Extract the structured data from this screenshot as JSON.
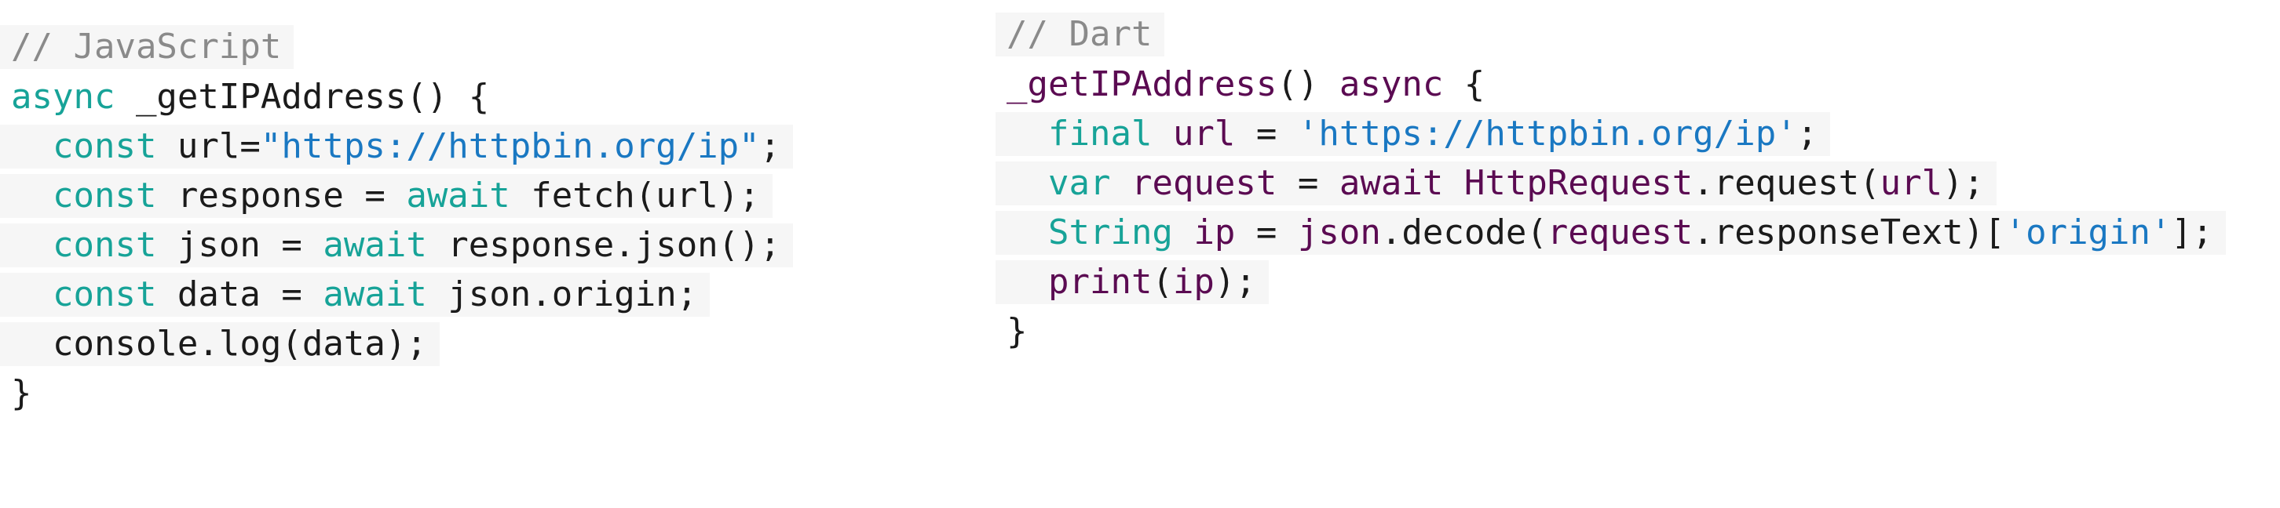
{
  "javascript": {
    "comment": "// JavaScript",
    "lines": [
      {
        "segs": [
          {
            "t": "async",
            "c": "kw-teal"
          },
          {
            "t": " _getIPAddress() {",
            "c": "plain"
          }
        ]
      },
      {
        "segs": [
          {
            "t": "  ",
            "c": "plain"
          },
          {
            "t": "const",
            "c": "kw-teal"
          },
          {
            "t": " url=",
            "c": "plain"
          },
          {
            "t": "\"https://httpbin.org/ip\"",
            "c": "str-blue"
          },
          {
            "t": ";",
            "c": "plain"
          }
        ]
      },
      {
        "segs": [
          {
            "t": "  ",
            "c": "plain"
          },
          {
            "t": "const",
            "c": "kw-teal"
          },
          {
            "t": " response = ",
            "c": "plain"
          },
          {
            "t": "await",
            "c": "kw-teal"
          },
          {
            "t": " fetch(url);",
            "c": "plain"
          }
        ]
      },
      {
        "segs": [
          {
            "t": "  ",
            "c": "plain"
          },
          {
            "t": "const",
            "c": "kw-teal"
          },
          {
            "t": " json = ",
            "c": "plain"
          },
          {
            "t": "await",
            "c": "kw-teal"
          },
          {
            "t": " response.json();",
            "c": "plain"
          }
        ]
      },
      {
        "segs": [
          {
            "t": "  ",
            "c": "plain"
          },
          {
            "t": "const",
            "c": "kw-teal"
          },
          {
            "t": " data = ",
            "c": "plain"
          },
          {
            "t": "await",
            "c": "kw-teal"
          },
          {
            "t": " json.origin;",
            "c": "plain"
          }
        ]
      },
      {
        "segs": [
          {
            "t": "  console.log(data);",
            "c": "plain"
          }
        ]
      },
      {
        "segs": [
          {
            "t": "}",
            "c": "plain"
          }
        ]
      }
    ]
  },
  "dart": {
    "comment": "// Dart",
    "lines": [
      {
        "segs": [
          {
            "t": "_getIPAddress",
            "c": "dart-id"
          },
          {
            "t": "() ",
            "c": "plain"
          },
          {
            "t": "async",
            "c": "dart-id"
          },
          {
            "t": " {",
            "c": "plain"
          }
        ]
      },
      {
        "segs": [
          {
            "t": "  ",
            "c": "plain"
          },
          {
            "t": "final",
            "c": "kw-teal"
          },
          {
            "t": " ",
            "c": "plain"
          },
          {
            "t": "url",
            "c": "dart-id"
          },
          {
            "t": " = ",
            "c": "plain"
          },
          {
            "t": "'https://httpbin.org/ip'",
            "c": "str-blue"
          },
          {
            "t": ";",
            "c": "plain"
          }
        ]
      },
      {
        "segs": [
          {
            "t": "  ",
            "c": "plain"
          },
          {
            "t": "var",
            "c": "kw-teal"
          },
          {
            "t": " ",
            "c": "plain"
          },
          {
            "t": "request",
            "c": "dart-id"
          },
          {
            "t": " = ",
            "c": "plain"
          },
          {
            "t": "await",
            "c": "dart-id"
          },
          {
            "t": " ",
            "c": "plain"
          },
          {
            "t": "HttpRequest",
            "c": "dart-id"
          },
          {
            "t": ".request(",
            "c": "plain"
          },
          {
            "t": "url",
            "c": "dart-id"
          },
          {
            "t": ");",
            "c": "plain"
          }
        ]
      },
      {
        "segs": [
          {
            "t": "  ",
            "c": "plain"
          },
          {
            "t": "String",
            "c": "kw-teal"
          },
          {
            "t": " ",
            "c": "plain"
          },
          {
            "t": "ip",
            "c": "dart-id"
          },
          {
            "t": " = ",
            "c": "plain"
          },
          {
            "t": "json",
            "c": "dart-id"
          },
          {
            "t": ".decode(",
            "c": "plain"
          },
          {
            "t": "request",
            "c": "dart-id"
          },
          {
            "t": ".responseText)[",
            "c": "plain"
          },
          {
            "t": "'origin'",
            "c": "str-blue"
          },
          {
            "t": "];",
            "c": "plain"
          }
        ]
      },
      {
        "segs": [
          {
            "t": "  ",
            "c": "plain"
          },
          {
            "t": "print",
            "c": "dart-id"
          },
          {
            "t": "(",
            "c": "plain"
          },
          {
            "t": "ip",
            "c": "dart-id"
          },
          {
            "t": ");",
            "c": "plain"
          }
        ]
      },
      {
        "segs": [
          {
            "t": "}",
            "c": "plain"
          }
        ]
      }
    ]
  }
}
